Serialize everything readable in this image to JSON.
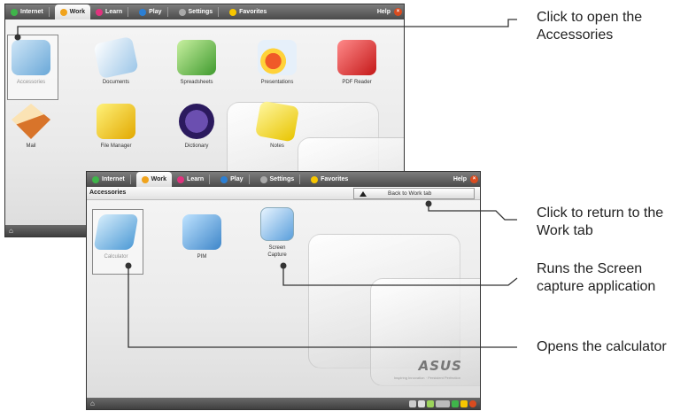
{
  "top_screen": {
    "tabs": [
      {
        "label": "Internet",
        "color": "#3fb54a"
      },
      {
        "label": "Work",
        "color": "#f0a31c"
      },
      {
        "label": "Learn",
        "color": "#e0337e"
      },
      {
        "label": "Play",
        "color": "#2b7fd4"
      },
      {
        "label": "Settings",
        "color": "#aaaaaa"
      },
      {
        "label": "Favorites",
        "color": "#f7c600"
      }
    ],
    "help_label": "Help",
    "apps": [
      {
        "label": "Accessories",
        "icon": "accessories-icon"
      },
      {
        "label": "Documents",
        "icon": "documents-icon"
      },
      {
        "label": "Spreadsheets",
        "icon": "spreadsheets-icon"
      },
      {
        "label": "Presentations",
        "icon": "presentations-icon"
      },
      {
        "label": "PDF Reader",
        "icon": "pdf-reader-icon"
      },
      {
        "label": "Mail",
        "icon": "mail-icon"
      },
      {
        "label": "File Manager",
        "icon": "file-manager-icon"
      },
      {
        "label": "Dictionary",
        "icon": "dictionary-icon"
      },
      {
        "label": "Notes",
        "icon": "notes-icon"
      }
    ]
  },
  "bottom_screen": {
    "tabs": [
      {
        "label": "Internet",
        "color": "#3fb54a"
      },
      {
        "label": "Work",
        "color": "#f0a31c"
      },
      {
        "label": "Learn",
        "color": "#e0337e"
      },
      {
        "label": "Play",
        "color": "#2b7fd4"
      },
      {
        "label": "Settings",
        "color": "#aaaaaa"
      },
      {
        "label": "Favorites",
        "color": "#f7c600"
      }
    ],
    "help_label": "Help",
    "section_title": "Accessories",
    "back_button": "Back to Work tab",
    "apps": [
      {
        "label": "Calculator",
        "icon": "calculator-icon"
      },
      {
        "label": "PIM",
        "icon": "pim-icon"
      },
      {
        "label": "Screen Capture",
        "icon": "screen-capture-icon"
      }
    ],
    "brand": "ASUS",
    "brand_tagline": "Inspiring Innovation · Persistent Perfection"
  },
  "callouts": {
    "accessories": "Click to open the Accessories",
    "back": "Click to return to the Work tab",
    "screen_capture": "Runs the Screen capture application",
    "calculator": "Opens the calculator"
  }
}
